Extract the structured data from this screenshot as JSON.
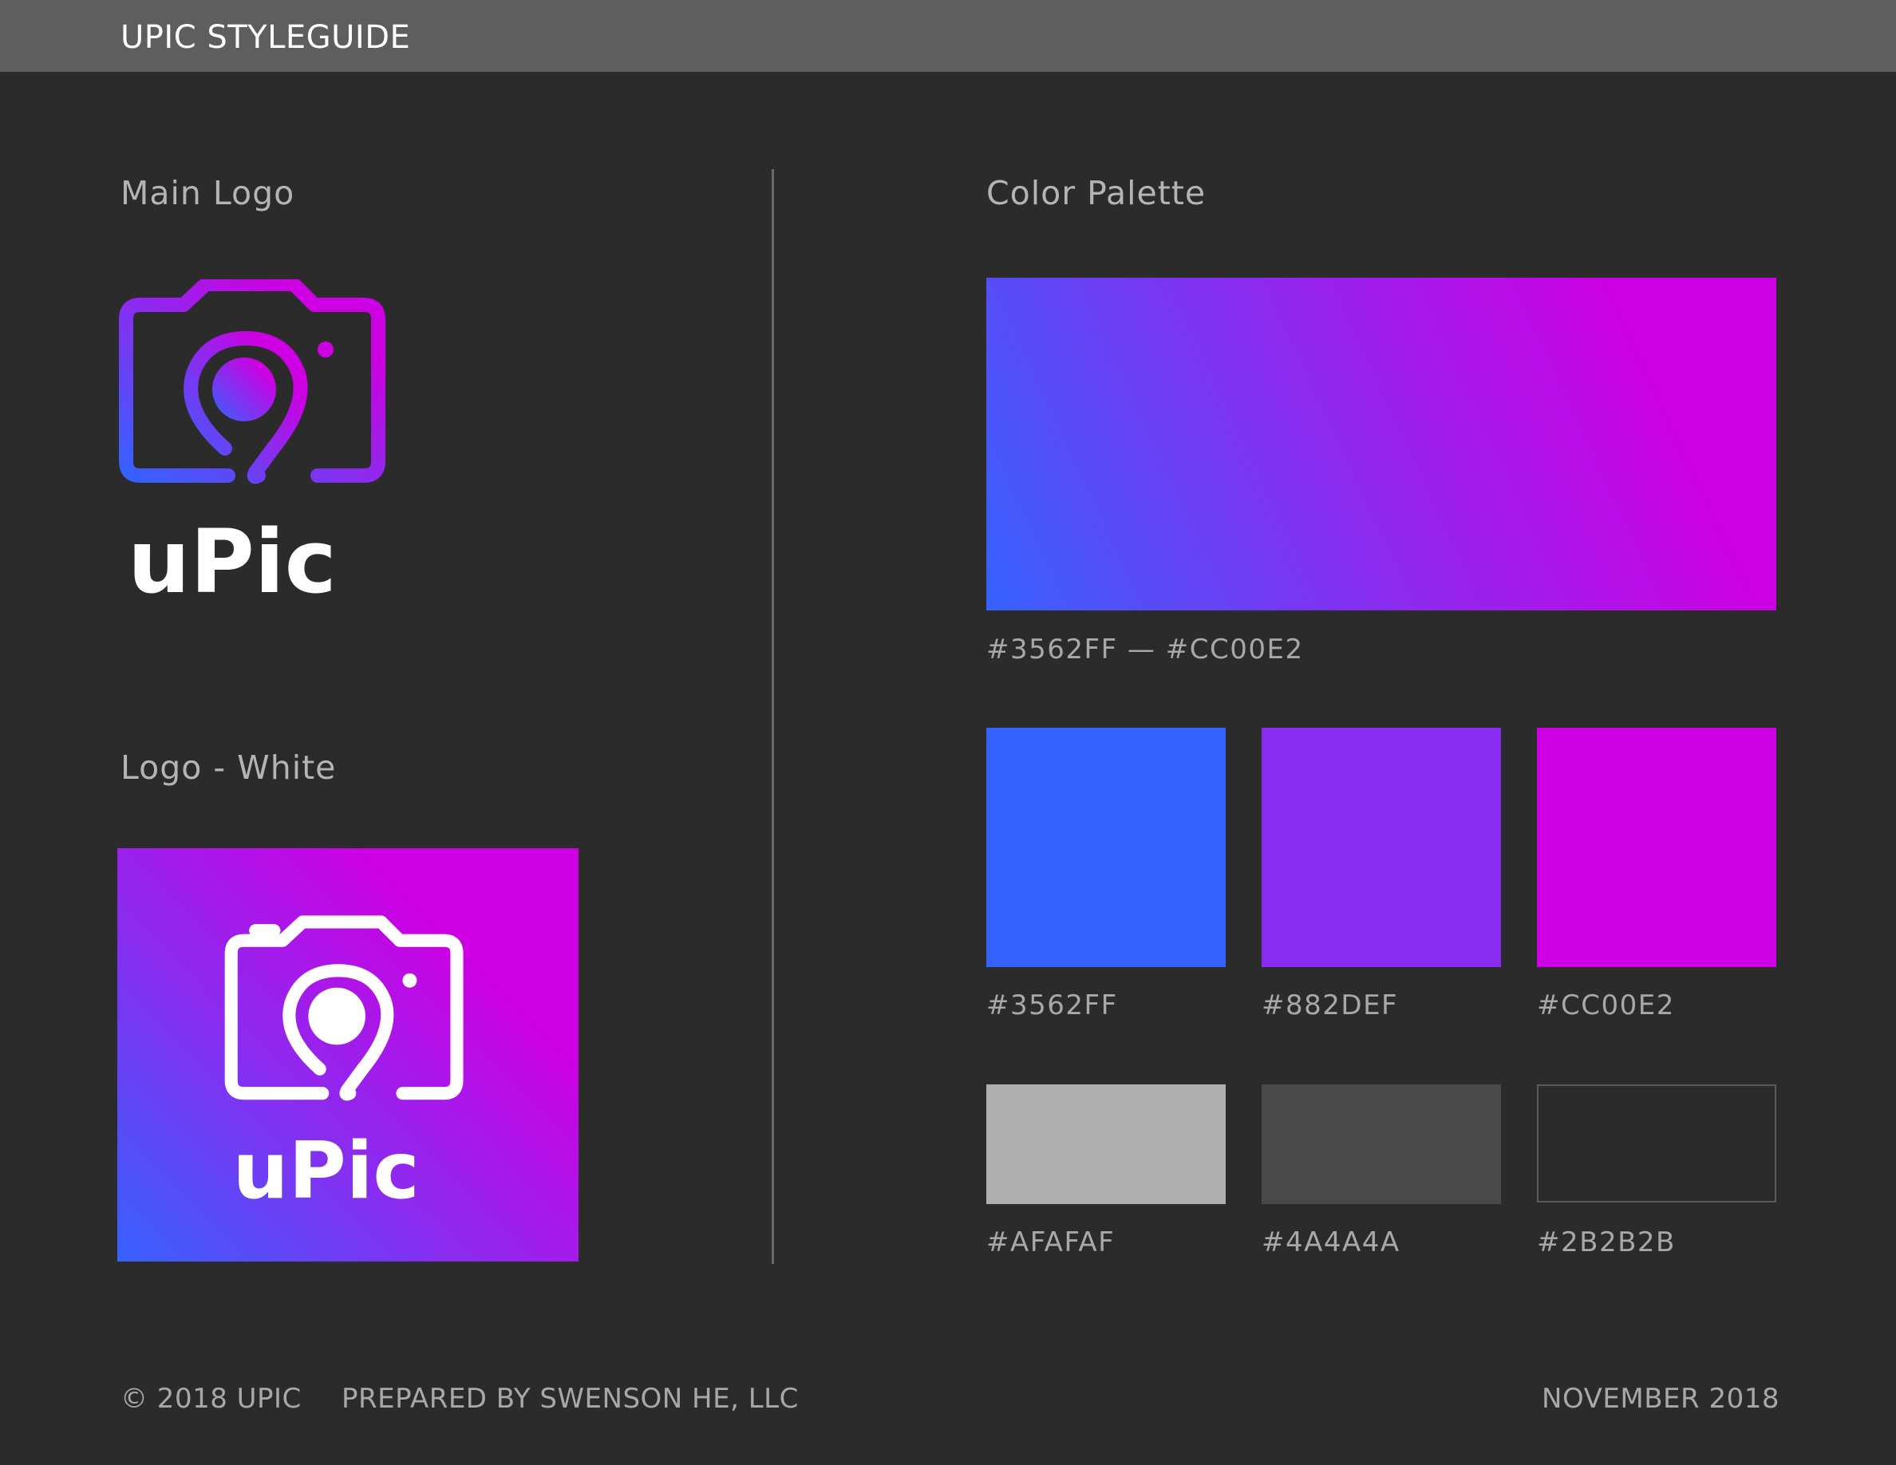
{
  "header": {
    "title": "UPIC STYLEGUIDE"
  },
  "sections": {
    "main_logo": "Main Logo",
    "logo_white": "Logo - White",
    "color_palette": "Color Palette"
  },
  "logo": {
    "wordmark": "uPic",
    "gradient_start": "#3562FF",
    "gradient_end": "#CC00E2"
  },
  "palette": {
    "gradient_label": "#3562FF — #CC00E2",
    "primary": [
      {
        "hex": "#3562FF",
        "label": "#3562FF"
      },
      {
        "hex": "#882DEF",
        "label": "#882DEF"
      },
      {
        "hex": "#CC00E2",
        "label": "#CC00E2"
      }
    ],
    "neutral": [
      {
        "hex": "#AFAFAF",
        "label": "#AFAFAF"
      },
      {
        "hex": "#4A4A4A",
        "label": "#4A4A4A"
      },
      {
        "hex": "#2B2B2B",
        "label": "#2B2B2B"
      }
    ]
  },
  "footer": {
    "copyright": "© 2018 UPIC",
    "prepared_by": "PREPARED BY SWENSON HE, LLC",
    "date": "NOVEMBER 2018"
  }
}
